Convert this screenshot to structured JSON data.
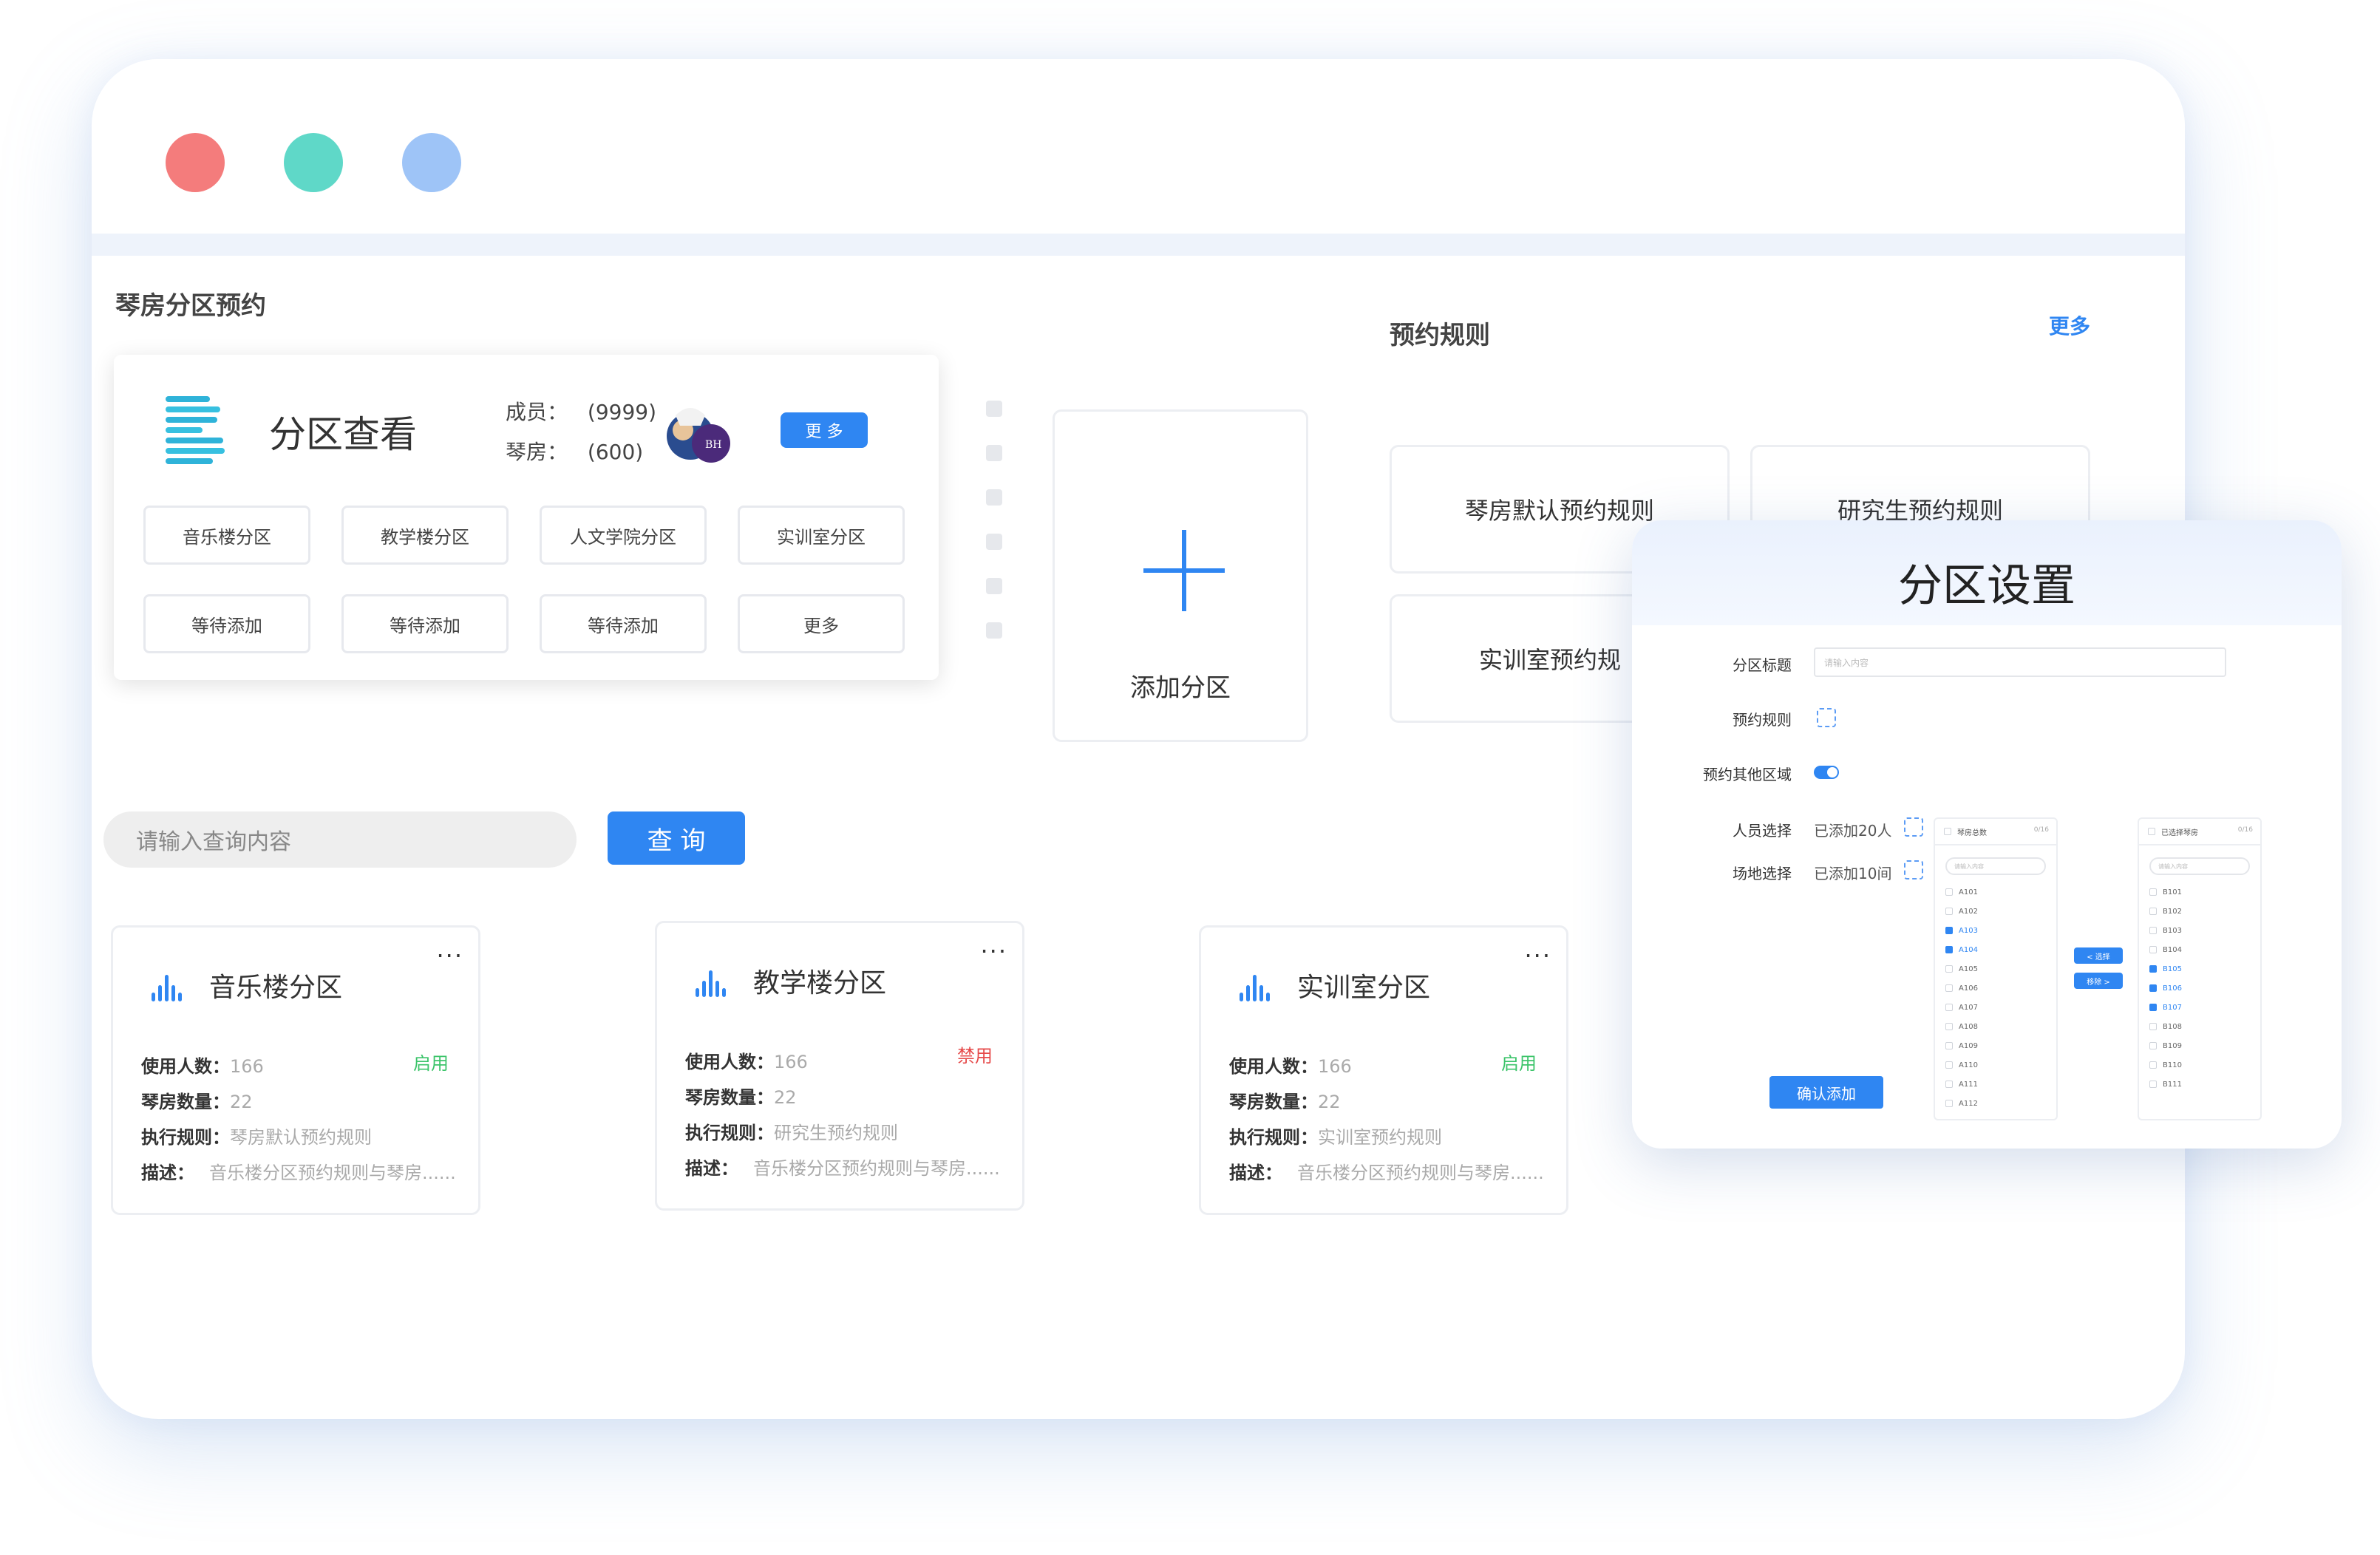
{
  "window": {
    "traffic_lights": [
      "#f47c7c",
      "#5fd8c8",
      "#9ec4f7"
    ]
  },
  "page": {
    "section_title": "琴房分区预约"
  },
  "zone_overview": {
    "title": "分区查看",
    "members_label": "成员：",
    "members_value": "(9999)",
    "rooms_label": "琴房：",
    "rooms_value": "(600)",
    "more_label": "更 多",
    "tags": [
      "音乐楼分区",
      "教学楼分区",
      "人文学院分区",
      "实训室分区",
      "等待添加",
      "等待添加",
      "等待添加",
      "更多"
    ]
  },
  "add_zone": {
    "label": "添加分区"
  },
  "rules": {
    "title": "预约规则",
    "more_label": "更多",
    "items": [
      "琴房默认预约规则",
      "研究生预约规则",
      "实训室预约规"
    ]
  },
  "search": {
    "placeholder": "请输入查询内容",
    "button_label": "查 询"
  },
  "zone_cards": [
    {
      "name": "音乐楼分区",
      "status": "启用",
      "status_color": "#3cc46a",
      "users_label": "使用人数：",
      "users": "166",
      "rooms_label": "琴房数量：",
      "rooms": "22",
      "rule_label": "执行规则：",
      "rule": "琴房默认预约规则",
      "desc_label": "描述：",
      "desc": "音乐楼分区预约规则与琴房......"
    },
    {
      "name": "教学楼分区",
      "status": "禁用",
      "status_color": "#e64a4a",
      "users_label": "使用人数：",
      "users": "166",
      "rooms_label": "琴房数量：",
      "rooms": "22",
      "rule_label": "执行规则：",
      "rule": "研究生预约规则",
      "desc_label": "描述：",
      "desc": "音乐楼分区预约规则与琴房......"
    },
    {
      "name": "实训室分区",
      "status": "启用",
      "status_color": "#3cc46a",
      "users_label": "使用人数：",
      "users": "166",
      "rooms_label": "琴房数量：",
      "rooms": "22",
      "rule_label": "执行规则：",
      "rule": "实训室预约规则",
      "desc_label": "描述：",
      "desc": "音乐楼分区预约规则与琴房......"
    }
  ],
  "zone_card_menu": "...",
  "dialog": {
    "title": "分区设置",
    "fields": {
      "zone_title_label": "分区标题",
      "zone_title_placeholder": "请输入内容",
      "rule_label": "预约规则",
      "other_area_label": "预约其他区域",
      "people_label": "人员选择",
      "people_value": "已添加20人",
      "venue_label": "场地选择",
      "venue_value": "已添加10间"
    },
    "transfer_left": {
      "title": "琴房总数",
      "count": "0/16",
      "search_placeholder": "请输入内容",
      "items": [
        "A101",
        "A102",
        "A103",
        "A104",
        "A105",
        "A106",
        "A107",
        "A108",
        "A109",
        "A110",
        "A111",
        "A112"
      ],
      "checked": [
        2,
        3
      ]
    },
    "transfer_right": {
      "title": "已选择琴房",
      "count": "0/16",
      "search_placeholder": "请输入内容",
      "items": [
        "B101",
        "B102",
        "B103",
        "B104",
        "B105",
        "B106",
        "B107",
        "B108",
        "B109",
        "B110",
        "B111"
      ],
      "checked": [
        4,
        5,
        6
      ]
    },
    "select_label": "< 选择",
    "remove_label": "移除 >",
    "confirm_label": "确认添加"
  }
}
